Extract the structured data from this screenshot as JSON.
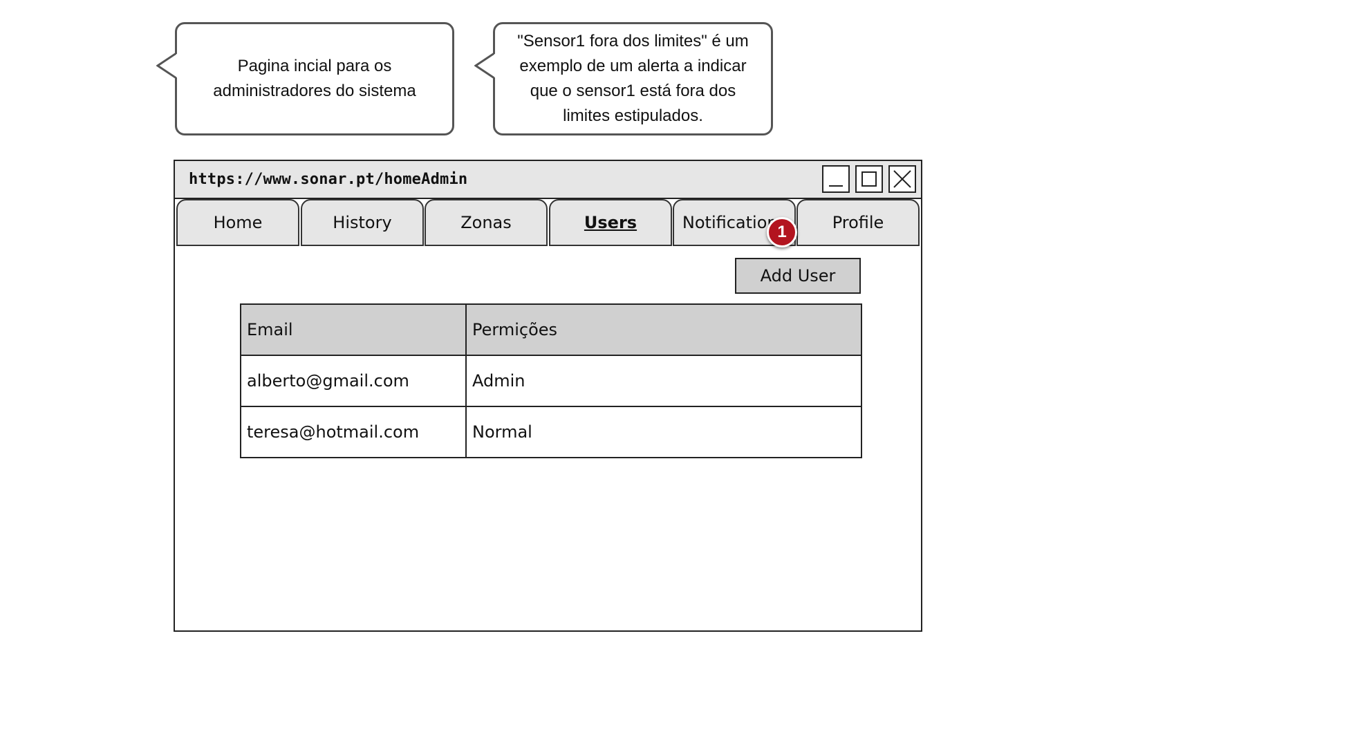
{
  "callouts": [
    {
      "text_line1": "Pagina incial para os",
      "text_line2": "administradores do sistema"
    },
    {
      "text_line1": "\"Sensor1 fora dos limites\" é um",
      "text_line2": "exemplo de um alerta a indicar",
      "text_line3": "que o sensor1 está fora dos",
      "text_line4": "limites estipulados."
    }
  ],
  "window": {
    "url": "https://www.sonar.pt/homeAdmin"
  },
  "tabs": [
    {
      "label": "Home"
    },
    {
      "label": "History"
    },
    {
      "label": "Zonas"
    },
    {
      "label": "Users",
      "active": true
    },
    {
      "label": "Notifications"
    },
    {
      "label": "Profile"
    }
  ],
  "notification_badge": "1",
  "colors": {
    "badge": "#b3141f",
    "tab_bg": "#e6e6e6",
    "header_bg": "#d0d0d0"
  },
  "actions": {
    "add_user_label": "Add User"
  },
  "table": {
    "headers": [
      "Email",
      "Permições"
    ],
    "rows": [
      [
        "alberto@gmail.com",
        "Admin"
      ],
      [
        "teresa@hotmail.com",
        "Normal"
      ]
    ]
  }
}
